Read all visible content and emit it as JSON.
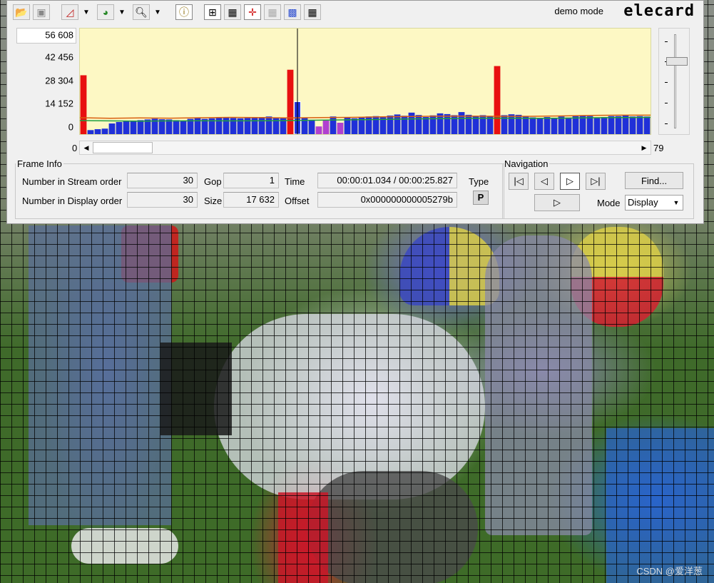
{
  "toolbar": {
    "demo_mode": "demo mode",
    "logo": "elecard",
    "icons": [
      "open-folder-icon",
      "save-icon",
      "graph-icon",
      "color-wheel-icon",
      "zoom-icon",
      "info-icon",
      "grid-layout-icon",
      "macroblock-icon",
      "motion-vector-icon",
      "grid-off-icon",
      "color-blocks-icon",
      "block-grid-icon"
    ]
  },
  "chart": {
    "y_ticks": [
      "56 608",
      "42 456",
      "28 304",
      "14 152",
      "0"
    ],
    "x_min_label": "0",
    "x_max_label": "79"
  },
  "chart_data": {
    "type": "bar",
    "ylim": [
      0,
      56608
    ],
    "ylabel": "",
    "xlabel": "",
    "cursor_frame": 30,
    "colors": {
      "I": "#e81010",
      "P": "#2030d8",
      "B": "#b040d0",
      "line_avg": "#d86010",
      "line_green": "#20a040"
    },
    "frames": [
      {
        "t": "I",
        "v": 32000
      },
      {
        "t": "P",
        "v": 2200
      },
      {
        "t": "P",
        "v": 2700
      },
      {
        "t": "P",
        "v": 3000
      },
      {
        "t": "P",
        "v": 5800
      },
      {
        "t": "P",
        "v": 6600
      },
      {
        "t": "P",
        "v": 7000
      },
      {
        "t": "P",
        "v": 7300
      },
      {
        "t": "P",
        "v": 7600
      },
      {
        "t": "P",
        "v": 8000
      },
      {
        "t": "P",
        "v": 8400
      },
      {
        "t": "P",
        "v": 8100
      },
      {
        "t": "P",
        "v": 8000
      },
      {
        "t": "P",
        "v": 7600
      },
      {
        "t": "P",
        "v": 7300
      },
      {
        "t": "P",
        "v": 8300
      },
      {
        "t": "P",
        "v": 8900
      },
      {
        "t": "P",
        "v": 8300
      },
      {
        "t": "P",
        "v": 8600
      },
      {
        "t": "P",
        "v": 9100
      },
      {
        "t": "P",
        "v": 9300
      },
      {
        "t": "P",
        "v": 8800
      },
      {
        "t": "P",
        "v": 8600
      },
      {
        "t": "P",
        "v": 8800
      },
      {
        "t": "P",
        "v": 8800
      },
      {
        "t": "P",
        "v": 9300
      },
      {
        "t": "P",
        "v": 9600
      },
      {
        "t": "P",
        "v": 9000
      },
      {
        "t": "P",
        "v": 8700
      },
      {
        "t": "I",
        "v": 35000
      },
      {
        "t": "P",
        "v": 17632
      },
      {
        "t": "P",
        "v": 9000
      },
      {
        "t": "P",
        "v": 7800
      },
      {
        "t": "B",
        "v": 4200
      },
      {
        "t": "B",
        "v": 7400
      },
      {
        "t": "P",
        "v": 9600
      },
      {
        "t": "B",
        "v": 6200
      },
      {
        "t": "P",
        "v": 9200
      },
      {
        "t": "P",
        "v": 8600
      },
      {
        "t": "P",
        "v": 9300
      },
      {
        "t": "P",
        "v": 9600
      },
      {
        "t": "P",
        "v": 9800
      },
      {
        "t": "P",
        "v": 9200
      },
      {
        "t": "P",
        "v": 10100
      },
      {
        "t": "P",
        "v": 10700
      },
      {
        "t": "P",
        "v": 10000
      },
      {
        "t": "P",
        "v": 11700
      },
      {
        "t": "P",
        "v": 10400
      },
      {
        "t": "P",
        "v": 9300
      },
      {
        "t": "P",
        "v": 10200
      },
      {
        "t": "P",
        "v": 11300
      },
      {
        "t": "P",
        "v": 10900
      },
      {
        "t": "P",
        "v": 10300
      },
      {
        "t": "P",
        "v": 12000
      },
      {
        "t": "P",
        "v": 10500
      },
      {
        "t": "P",
        "v": 9600
      },
      {
        "t": "P",
        "v": 10300
      },
      {
        "t": "P",
        "v": 9900
      },
      {
        "t": "I",
        "v": 37000
      },
      {
        "t": "P",
        "v": 10300
      },
      {
        "t": "P",
        "v": 10800
      },
      {
        "t": "P",
        "v": 10500
      },
      {
        "t": "P",
        "v": 9800
      },
      {
        "t": "P",
        "v": 9100
      },
      {
        "t": "P",
        "v": 8700
      },
      {
        "t": "P",
        "v": 9300
      },
      {
        "t": "P",
        "v": 8900
      },
      {
        "t": "P",
        "v": 9600
      },
      {
        "t": "P",
        "v": 9000
      },
      {
        "t": "P",
        "v": 9800
      },
      {
        "t": "P",
        "v": 10100
      },
      {
        "t": "P",
        "v": 9800
      },
      {
        "t": "P",
        "v": 9100
      },
      {
        "t": "P",
        "v": 9300
      },
      {
        "t": "P",
        "v": 9800
      },
      {
        "t": "P",
        "v": 9800
      },
      {
        "t": "P",
        "v": 10100
      },
      {
        "t": "P",
        "v": 9600
      },
      {
        "t": "P",
        "v": 9800
      },
      {
        "t": "P",
        "v": 9600
      }
    ],
    "avg_line": [
      8900,
      8600,
      8800,
      8700,
      8900,
      9100,
      9000,
      8800,
      9000,
      9100,
      9400,
      9600,
      9800,
      9800,
      9700,
      9700,
      9900,
      10200,
      10300,
      10300
    ],
    "green_line": [
      7400,
      7200,
      7100,
      7200,
      7300,
      7200,
      7300,
      7400,
      7600,
      7800,
      8000,
      8300,
      8400,
      8600,
      8700,
      8600,
      8700,
      8900,
      9000,
      9100
    ]
  },
  "frame_info": {
    "legend": "Frame Info",
    "stream_order_label": "Number in Stream order",
    "stream_order": "30",
    "display_order_label": "Number in Display order",
    "display_order": "30",
    "gop_label": "Gop",
    "gop": "1",
    "size_label": "Size",
    "size": "17 632",
    "time_label": "Time",
    "time": "00:00:01.034 / 00:00:25.827",
    "offset_label": "Offset",
    "offset": "0x000000000005279b",
    "type_label": "Type",
    "type": "P"
  },
  "navigation": {
    "legend": "Navigation",
    "first": "|◁",
    "prev": "◁",
    "next": "▷",
    "last": "▷|",
    "play": "▷",
    "find": "Find...",
    "mode_label": "Mode",
    "mode_value": "Display"
  },
  "watermark": "CSDN @爱洋葱"
}
